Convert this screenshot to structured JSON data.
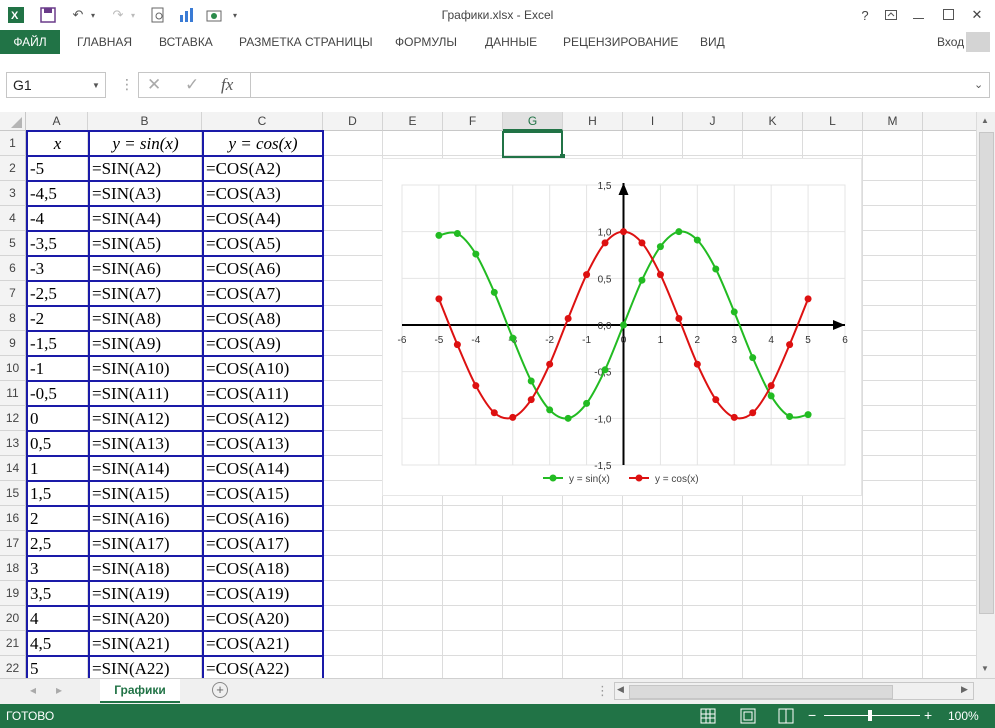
{
  "window": {
    "title": "Графики.xlsx - Excel",
    "sign_in": "Вход",
    "help": "?"
  },
  "ribbon": {
    "file_tab": "ФАЙЛ",
    "tabs": [
      "ГЛАВНАЯ",
      "ВСТАВКА",
      "РАЗМЕТКА СТРАНИЦЫ",
      "ФОРМУЛЫ",
      "ДАННЫЕ",
      "РЕЦЕНЗИРОВАНИЕ",
      "ВИД"
    ]
  },
  "formula_bar": {
    "name_box": "G1",
    "fx": "fx",
    "cancel_icon": "✕",
    "enter_icon": "✓",
    "formula": ""
  },
  "grid": {
    "columns": [
      "A",
      "B",
      "C",
      "D",
      "E",
      "F",
      "G",
      "H",
      "I",
      "J",
      "K",
      "L",
      "M"
    ],
    "selected_column": "G",
    "rows": [
      "1",
      "2",
      "3",
      "4",
      "5",
      "6",
      "7",
      "8",
      "9",
      "10",
      "11",
      "12",
      "13",
      "14",
      "15",
      "16",
      "17",
      "18",
      "19",
      "20",
      "21",
      "22"
    ],
    "header_row": [
      "x",
      "y = sin(x)",
      "y = cos(x)"
    ],
    "data_rows": [
      [
        "-5",
        "=SIN(A2)",
        "=COS(A2)"
      ],
      [
        "-4,5",
        "=SIN(A3)",
        "=COS(A3)"
      ],
      [
        "-4",
        "=SIN(A4)",
        "=COS(A4)"
      ],
      [
        "-3,5",
        "=SIN(A5)",
        "=COS(A5)"
      ],
      [
        "-3",
        "=SIN(A6)",
        "=COS(A6)"
      ],
      [
        "-2,5",
        "=SIN(A7)",
        "=COS(A7)"
      ],
      [
        "-2",
        "=SIN(A8)",
        "=COS(A8)"
      ],
      [
        "-1,5",
        "=SIN(A9)",
        "=COS(A9)"
      ],
      [
        "-1",
        "=SIN(A10)",
        "=COS(A10)"
      ],
      [
        "-0,5",
        "=SIN(A11)",
        "=COS(A11)"
      ],
      [
        "0",
        "=SIN(A12)",
        "=COS(A12)"
      ],
      [
        "0,5",
        "=SIN(A13)",
        "=COS(A13)"
      ],
      [
        "1",
        "=SIN(A14)",
        "=COS(A14)"
      ],
      [
        "1,5",
        "=SIN(A15)",
        "=COS(A15)"
      ],
      [
        "2",
        "=SIN(A16)",
        "=COS(A16)"
      ],
      [
        "2,5",
        "=SIN(A17)",
        "=COS(A17)"
      ],
      [
        "3",
        "=SIN(A18)",
        "=COS(A18)"
      ],
      [
        "3,5",
        "=SIN(A19)",
        "=COS(A19)"
      ],
      [
        "4",
        "=SIN(A20)",
        "=COS(A20)"
      ],
      [
        "4,5",
        "=SIN(A21)",
        "=COS(A21)"
      ],
      [
        "5",
        "=SIN(A22)",
        "=COS(A22)"
      ]
    ]
  },
  "chart_data": {
    "type": "scatter",
    "title": "",
    "xlabel": "",
    "ylabel": "",
    "xlim": [
      -6,
      6
    ],
    "ylim": [
      -1.5,
      1.5
    ],
    "x_ticks": [
      "-6",
      "-5",
      "-4",
      "-3",
      "-2",
      "-1",
      "0",
      "1",
      "2",
      "3",
      "4",
      "5",
      "6"
    ],
    "y_ticks": [
      "1,5",
      "1,0",
      "0,5",
      "0,0",
      "-0,5",
      "-1,0",
      "-1,5"
    ],
    "grid": true,
    "legend": "bottom",
    "x": [
      -5,
      -4.5,
      -4,
      -3.5,
      -3,
      -2.5,
      -2,
      -1.5,
      -1,
      -0.5,
      0,
      0.5,
      1,
      1.5,
      2,
      2.5,
      3,
      3.5,
      4,
      4.5,
      5
    ],
    "series": [
      {
        "name": "y = sin(x)",
        "color": "#22bb22",
        "values": [
          0.96,
          0.98,
          0.76,
          0.35,
          -0.14,
          -0.6,
          -0.91,
          -1.0,
          -0.84,
          -0.48,
          0.0,
          0.48,
          0.84,
          1.0,
          0.91,
          0.6,
          0.14,
          -0.35,
          -0.76,
          -0.98,
          -0.96
        ]
      },
      {
        "name": "y = cos(x)",
        "color": "#dd1111",
        "values": [
          0.28,
          -0.21,
          -0.65,
          -0.94,
          -0.99,
          -0.8,
          -0.42,
          0.07,
          0.54,
          0.88,
          1.0,
          0.88,
          0.54,
          0.07,
          -0.42,
          -0.8,
          -0.99,
          -0.94,
          -0.65,
          -0.21,
          0.28
        ]
      }
    ]
  },
  "sheets": {
    "active": "Графики"
  },
  "status": {
    "ready": "ГОТОВО",
    "zoom": "100%"
  }
}
